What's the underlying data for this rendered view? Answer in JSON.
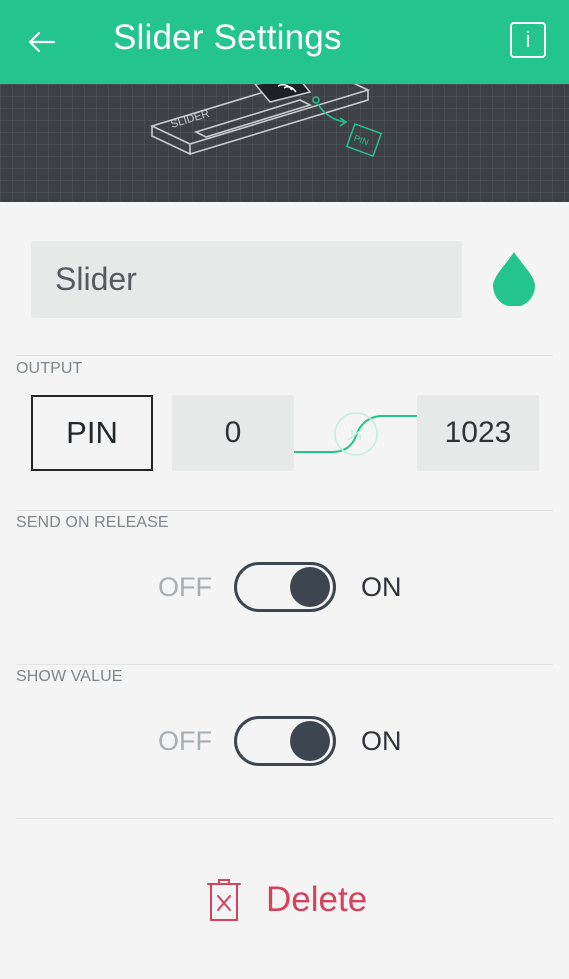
{
  "header": {
    "title": "Slider Settings",
    "back_icon": "arrow-left-icon",
    "info_label": "i"
  },
  "hero": {
    "device_label": "SLIDER",
    "pin_label": "PIN"
  },
  "name_field": {
    "value": "Slider"
  },
  "color": {
    "accent": "#23c48e",
    "delete": "#d3435c"
  },
  "output": {
    "label": "OUTPUT",
    "pin_label": "PIN",
    "min": "0",
    "max": "1023"
  },
  "send_on_release": {
    "label": "SEND ON RELEASE",
    "off": "OFF",
    "on": "ON",
    "state": "on"
  },
  "show_value": {
    "label": "SHOW VALUE",
    "off": "OFF",
    "on": "ON",
    "state": "on"
  },
  "delete": {
    "label": "Delete"
  }
}
